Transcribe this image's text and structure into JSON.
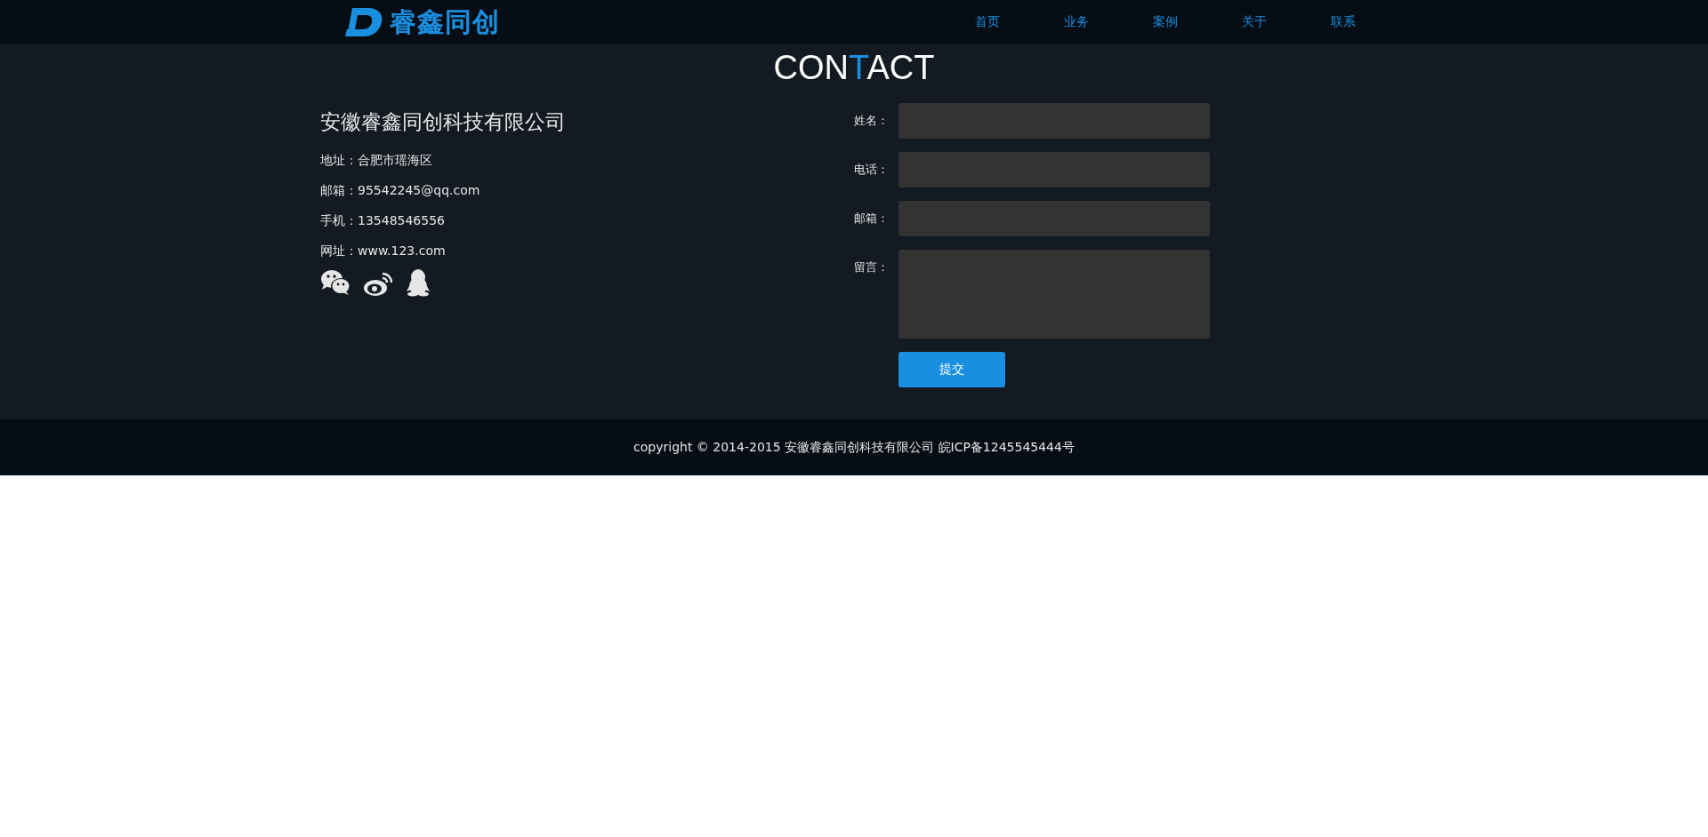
{
  "header": {
    "logo_text": "睿鑫同创",
    "nav": [
      {
        "label": "首页"
      },
      {
        "label": "业务"
      },
      {
        "label": "案例"
      },
      {
        "label": "关于"
      },
      {
        "label": "联系"
      }
    ]
  },
  "heading": {
    "before": "CON",
    "accent": "T",
    "after": "ACT"
  },
  "company": {
    "name": "安徽睿鑫同创科技有限公司",
    "details": [
      {
        "label": "地址：",
        "value": "合肥市瑶海区"
      },
      {
        "label": "邮箱：",
        "value": "95542245@qq.com"
      },
      {
        "label": "手机：",
        "value": "13548546556"
      },
      {
        "label": "网址：",
        "value": "www.123.com"
      }
    ],
    "social": [
      {
        "kind": "wechat"
      },
      {
        "kind": "weibo"
      },
      {
        "kind": "qq"
      }
    ]
  },
  "form": {
    "fields": [
      {
        "label": "姓名：",
        "kind": "input"
      },
      {
        "label": "电话：",
        "kind": "input"
      },
      {
        "label": "邮箱：",
        "kind": "input"
      },
      {
        "label": "留言：",
        "kind": "textarea"
      }
    ],
    "submit": "提交"
  },
  "footer": {
    "text": "copyright © 2014-2015 安徽睿鑫同创科技有限公司 皖ICP备1245545444号"
  }
}
